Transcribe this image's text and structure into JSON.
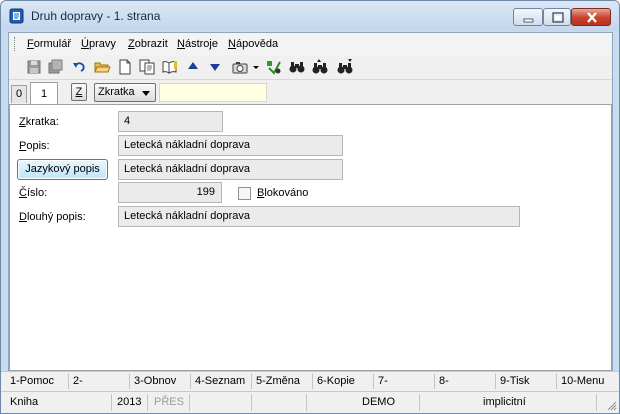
{
  "window": {
    "title": "Druh dopravy - 1. strana"
  },
  "menu": {
    "items": [
      "Formulář",
      "Úpravy",
      "Zobrazit",
      "Nástroje",
      "Nápověda"
    ]
  },
  "toolbar": {
    "icons": [
      "save-icon",
      "save-all-icon",
      "undo-icon",
      "open-folder-icon",
      "new-document-icon",
      "copy-icon",
      "book-icon",
      "arrow-up-icon",
      "arrow-down-icon",
      "camera-icon",
      "dropdown-arrow-icon",
      "filter-icon",
      "binoculars-icon",
      "binoculars-next-icon",
      "binoculars-all-icon"
    ]
  },
  "tabs": {
    "items": [
      "0",
      "1"
    ],
    "active": "1",
    "z_button": "Z",
    "sort_combo": "Zkratka",
    "search_value": ""
  },
  "form": {
    "zkratka_label": "Zkratka:",
    "zkratka_value": "4",
    "popis_label": "Popis:",
    "popis_value": "Letecká nákladní doprava",
    "jazykovy_button": "Jazykový popis",
    "jazykovy_value": "Letecká nákladní doprava",
    "cislo_label": "Číslo:",
    "cislo_value": "199",
    "blokovano_label": "Blokováno",
    "blokovano_checked": false,
    "dlouhy_label": "Dlouhý popis:",
    "dlouhy_value": "Letecká nákladní doprava"
  },
  "fkeys": [
    "1-Pomoc",
    "2-",
    "3-Obnov",
    "4-Seznam",
    "5-Změna",
    "6-Kopie",
    "7-",
    "8-",
    "9-Tisk",
    "10-Menu"
  ],
  "status": {
    "module": "Kniha",
    "year": "2013",
    "mode": "PŘES",
    "db": "DEMO",
    "profile": "implicitní"
  },
  "colors": {
    "titlebar": "#c9dcef",
    "search_bg": "#ffffe1",
    "close_button": "#c7412b"
  }
}
